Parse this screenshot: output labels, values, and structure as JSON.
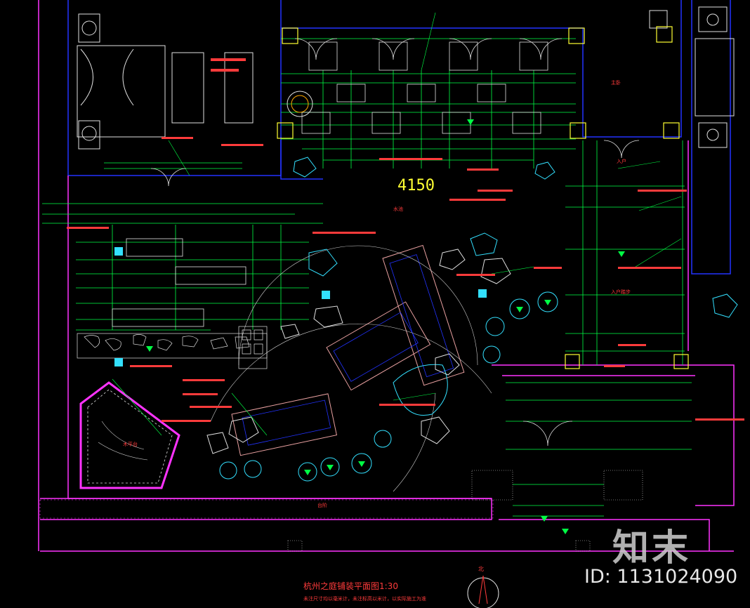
{
  "drawing": {
    "title": "杭州之庭铺装平面图1:30",
    "note": "未注尺寸均以毫米计，未注标高以米计，以实际施工为准",
    "big_dimension": "4150",
    "north_label": "北",
    "watermark_logo": "知末",
    "watermark_id": "ID: 1131024090"
  },
  "labels": {
    "entry": "入户",
    "stair": "台阶",
    "bedroom": "主卧",
    "entrance_steps": "入户踏步",
    "water": "水池",
    "wood_deck": "木平台"
  },
  "colors": {
    "background": "#000000",
    "wall": "#ff33ff",
    "building": "#2233ff",
    "dimension": "#00ff44",
    "text": "#ff3b3b",
    "accent": "#ffff33",
    "stone": "#33e0ff",
    "paving": "#e0e0e0"
  }
}
